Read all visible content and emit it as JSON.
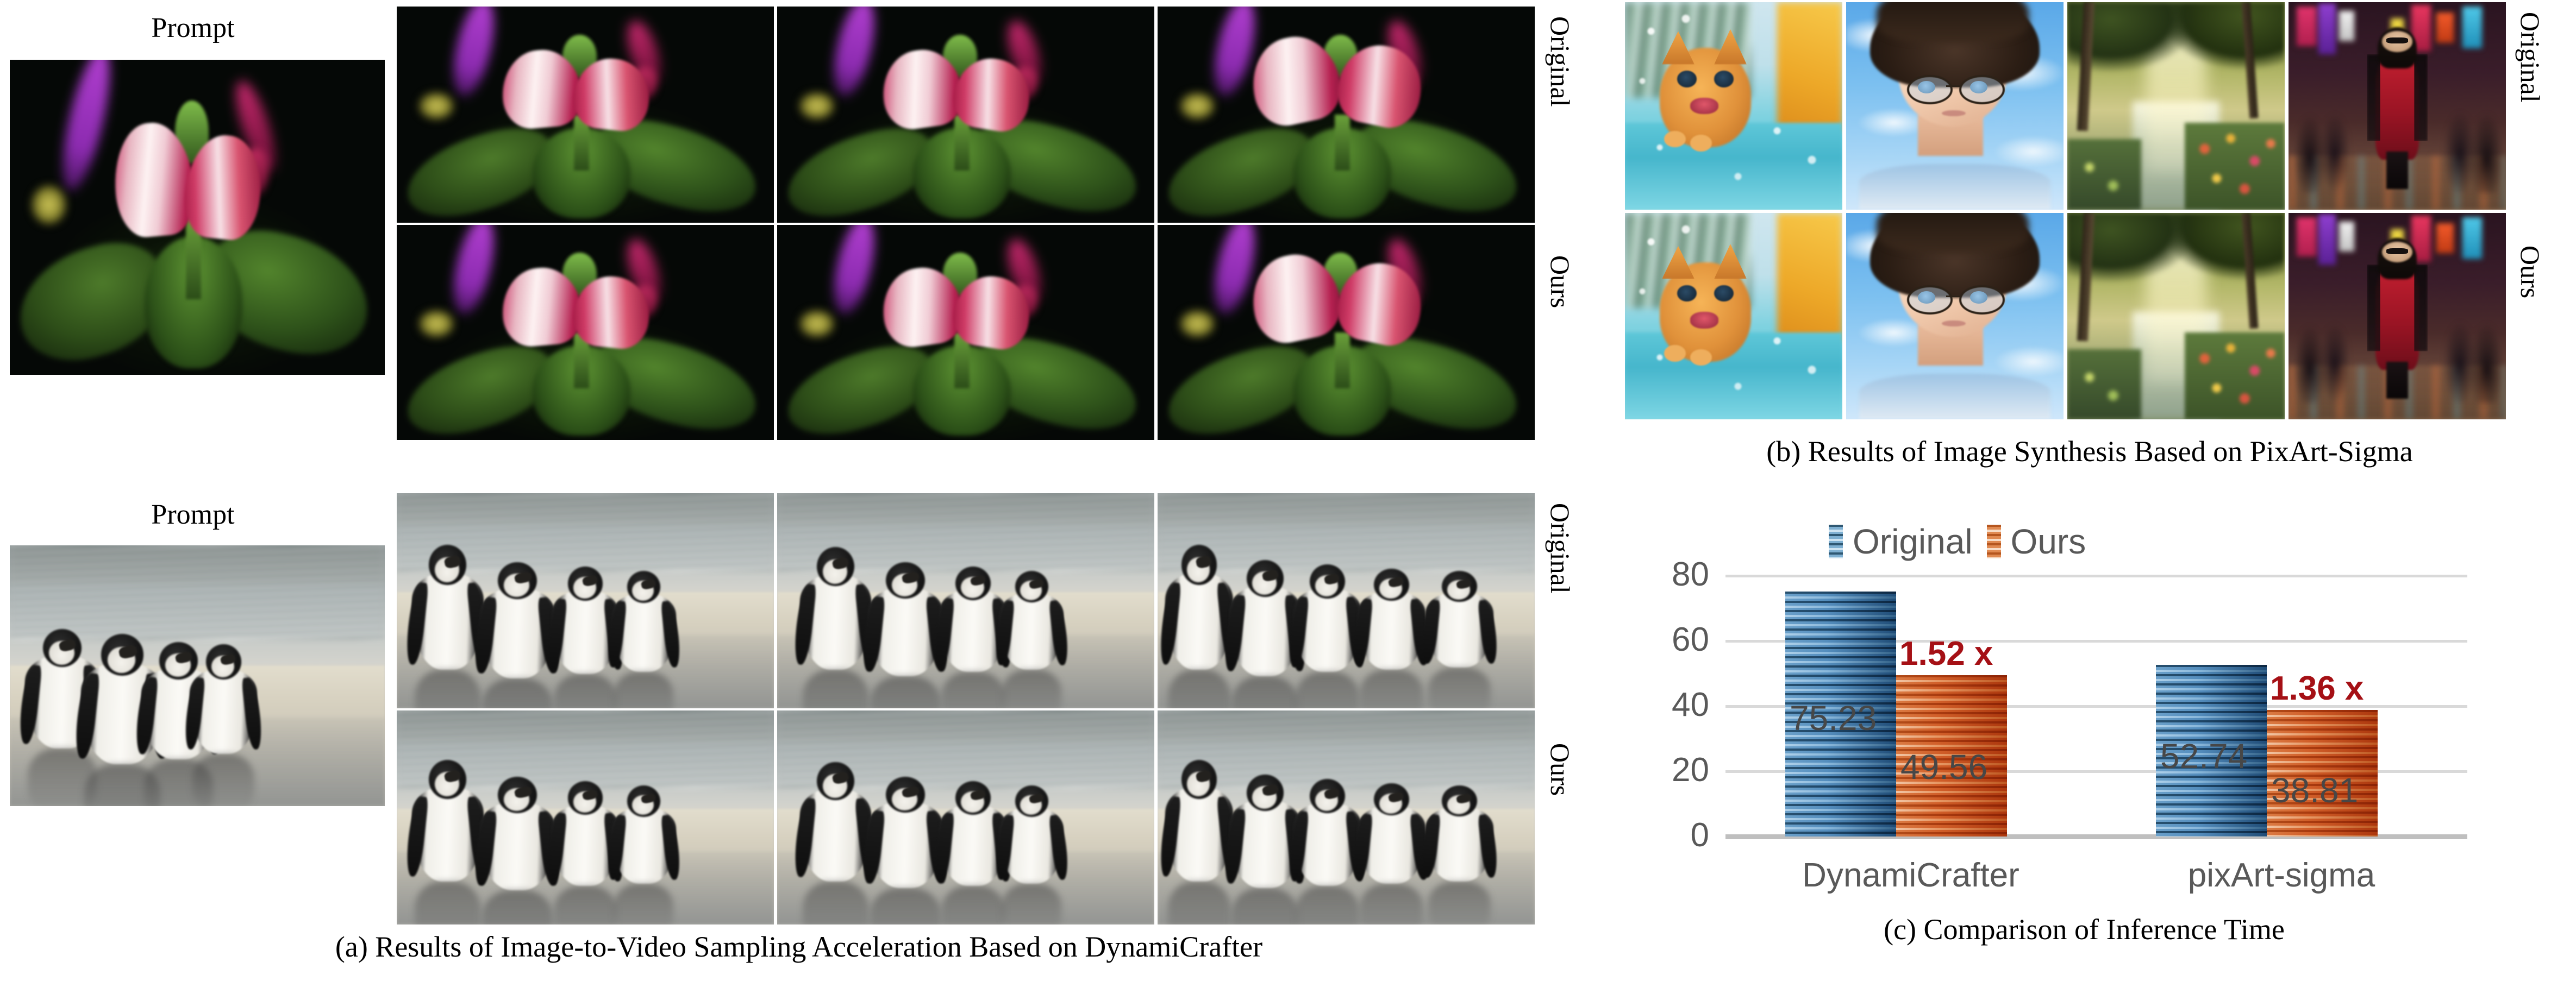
{
  "figure": {
    "panel_a": {
      "caption": "(a) Results of Image-to-Video Sampling Acceleration Based on DynamiCrafter",
      "prompt_label_top": "Prompt",
      "prompt_label_bottom": "Prompt",
      "row_labels_top": [
        "Original",
        "Ours"
      ],
      "row_labels_bottom": [
        "Original",
        "Ours"
      ],
      "frames_per_row": 3,
      "examples": [
        {
          "name": "flower-bud",
          "frames": [
            "frame-1",
            "frame-2",
            "frame-3"
          ]
        },
        {
          "name": "penguins-beach",
          "frames": [
            "frame-1",
            "frame-2",
            "frame-3"
          ]
        }
      ]
    },
    "panel_b": {
      "caption": "(b) Results of Image Synthesis Based on PixArt-Sigma",
      "row_labels": [
        "Original",
        "Ours"
      ],
      "columns": [
        "snow-kitten",
        "anime-boy-glasses",
        "sunlit-forest-path",
        "red-dress-neon-street"
      ]
    },
    "panel_c": {
      "caption": "(c) Comparison of Inference Time"
    }
  },
  "chart_data": {
    "type": "bar",
    "title": "",
    "xlabel": "",
    "ylabel": "",
    "categories": [
      "DynamiCrafter",
      "pixArt-sigma"
    ],
    "series": [
      {
        "name": "Original",
        "values": [
          75.23,
          52.74
        ],
        "color": "#3f6e90"
      },
      {
        "name": "Ours",
        "values": [
          49.56,
          38.81
        ],
        "color": "#c4662a"
      }
    ],
    "data_labels": [
      [
        "75.23",
        "49.56"
      ],
      [
        "52.74",
        "38.81"
      ]
    ],
    "annotations": [
      "1.52 x",
      "1.36 x"
    ],
    "annotation_color": "#A51015",
    "legend": [
      "Original",
      "Ours"
    ],
    "legend_position": "top-center",
    "yticks": [
      "80",
      "60",
      "40",
      "20",
      "0"
    ],
    "ylim": [
      0,
      80
    ],
    "grid": true,
    "tick_color": "#595959"
  }
}
